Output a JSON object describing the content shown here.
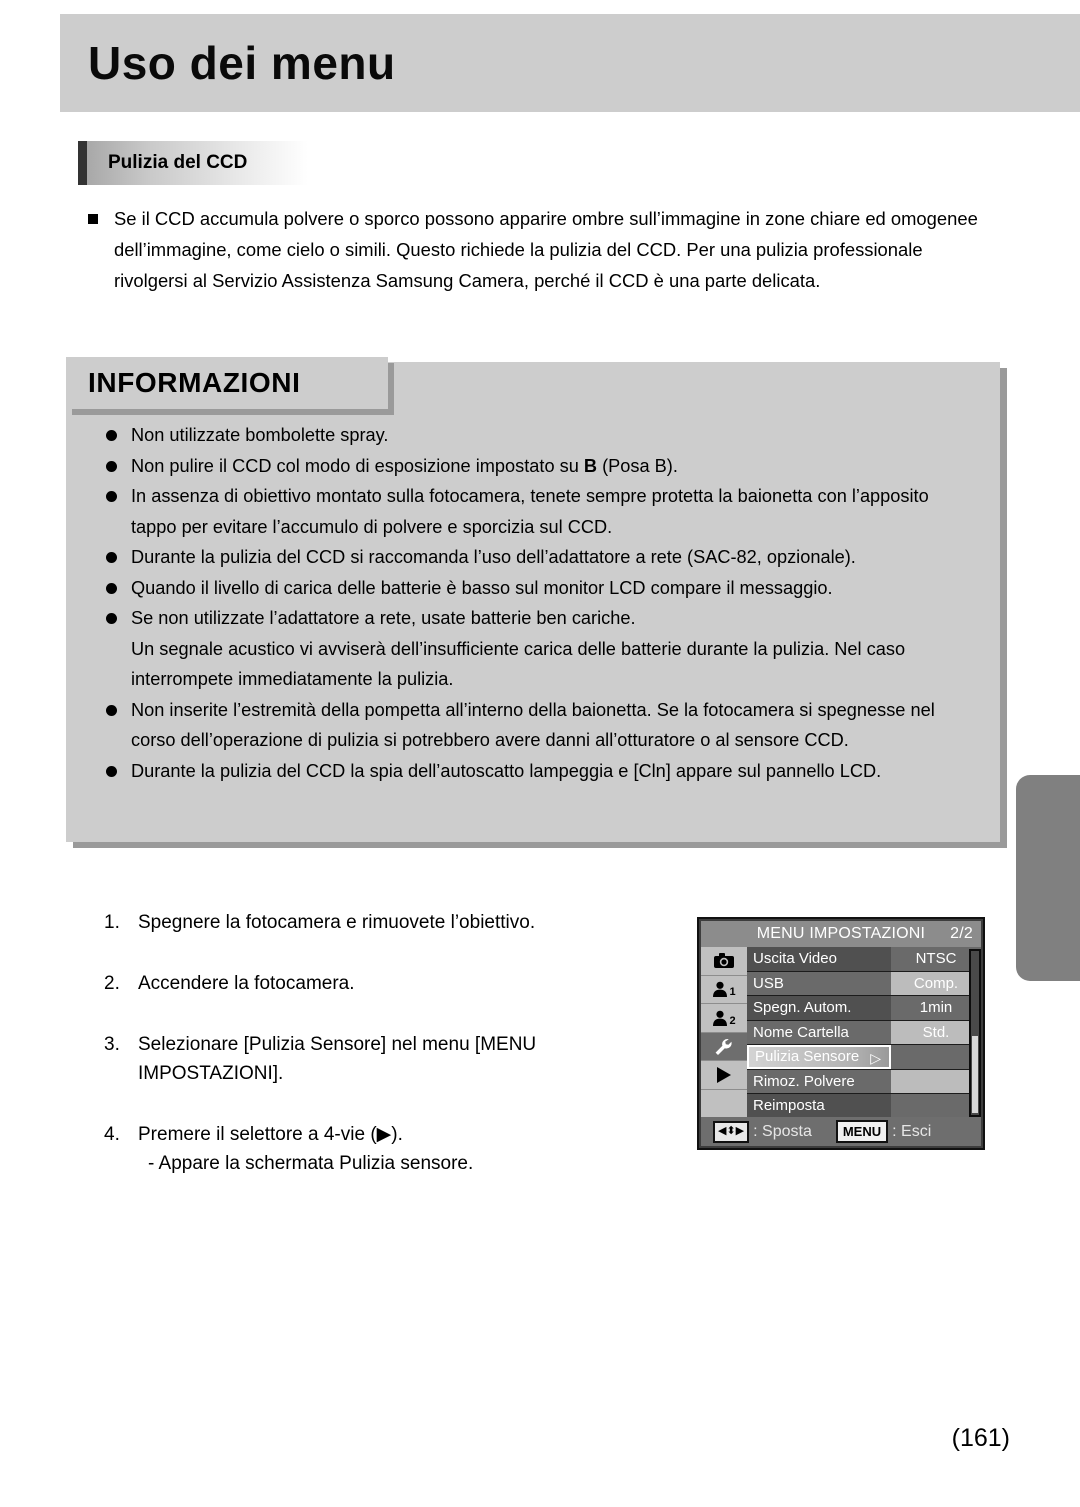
{
  "header": {
    "title": "Uso dei menu"
  },
  "section": {
    "subtitle": "Pulizia del CCD"
  },
  "intro": {
    "bullet_icon": "square-bullet-icon",
    "text": "Se il CCD accumula polvere o sporco possono apparire ombre sull’immagine in zone chiare ed omogenee dell’immagine, come cielo o simili. Questo richiede la pulizia del CCD. Per una pulizia professionale rivolgersi al Servizio Assistenza Samsung Camera, perché il CCD è una parte delicata."
  },
  "info": {
    "tag": "INFORMAZIONI",
    "items": [
      {
        "text": "Non utilizzate bombolette spray."
      },
      {
        "pre": "Non pulire il CCD col modo di esposizione impostato su ",
        "bold": "B",
        "post": " (Posa B)."
      },
      {
        "text": "In assenza di obiettivo montato sulla fotocamera, tenete sempre protetta la baionetta con l’apposito tappo per evitare l’accumulo di polvere e sporcizia sul CCD."
      },
      {
        "text": "Durante la pulizia del CCD si raccomanda l’uso dell’adattatore a rete (SAC-82, opzionale)."
      },
      {
        "text": "Quando il livello di carica delle batterie è basso sul monitor LCD compare il messaggio."
      },
      {
        "text": "Se non utilizzate l’adattatore a rete, usate batterie ben cariche.",
        "cont": "Un segnale acustico vi avviserà dell’insufficiente carica delle batterie durante la pulizia. Nel caso interrompete immediatamente la pulizia."
      },
      {
        "text": "Non inserite l’estremità della pompetta all’interno della baionetta. Se la fotocamera si spegnesse nel corso dell’operazione di pulizia si potrebbero avere danni all’otturatore o al sensore CCD."
      },
      {
        "text": "Durante la pulizia del CCD la spia dell’autoscatto lampeggia e [Cln] appare sul pannello LCD."
      }
    ]
  },
  "steps": [
    {
      "num": "1.",
      "text": "Spegnere la fotocamera e rimuovete l’obiettivo."
    },
    {
      "num": "2.",
      "text": "Accendere la fotocamera."
    },
    {
      "num": "3.",
      "text": "Selezionare [Pulizia Sensore] nel menu [MENU",
      "line2": "IMPOSTAZIONI]."
    },
    {
      "num": "4.",
      "text": "Premere il selettore a 4-vie (▶).",
      "sub": "- Appare la schermata Pulizia sensore."
    }
  ],
  "lcd": {
    "title": "MENU IMPOSTAZIONI",
    "page": "2/2",
    "icons": [
      {
        "name": "camera-icon",
        "sub": "",
        "selected": false
      },
      {
        "name": "user1-icon",
        "sub": "1",
        "selected": false
      },
      {
        "name": "user2-icon",
        "sub": "2",
        "selected": false
      },
      {
        "name": "wrench-icon",
        "sub": "",
        "selected": true
      },
      {
        "name": "play-icon",
        "sub": "",
        "selected": false
      }
    ],
    "rows": [
      {
        "label": "Uscita Video",
        "value": "NTSC",
        "label_tone": "tone-dark",
        "value_tone": "tone-mid",
        "selected": false,
        "corner": false
      },
      {
        "label": "USB",
        "value": "Comp.",
        "label_tone": "tone-mid",
        "value_tone": "tone-light",
        "selected": false,
        "corner": false
      },
      {
        "label": "Spegn. Autom.",
        "value": "1min",
        "label_tone": "tone-dark",
        "value_tone": "tone-mid",
        "selected": false,
        "corner": false
      },
      {
        "label": "Nome Cartella",
        "value": "Std.",
        "label_tone": "tone-mid",
        "value_tone": "tone-light",
        "selected": false,
        "corner": false
      },
      {
        "label": "Pulizia Sensore",
        "value": "",
        "label_tone": "tone-light",
        "value_tone": "tone-mid",
        "selected": true,
        "corner": true
      },
      {
        "label": "Rimoz. Polvere",
        "value": "",
        "label_tone": "tone-mid",
        "value_tone": "tone-light",
        "selected": false,
        "corner": true
      },
      {
        "label": "Reimposta",
        "value": "",
        "label_tone": "tone-dark",
        "value_tone": "tone-mid",
        "selected": false,
        "corner": true
      }
    ],
    "footer": {
      "key_4way": "◀⬍▶",
      "move_label": ": Sposta",
      "key_menu": "MENU",
      "exit_label": ": Esci"
    }
  },
  "page_number": "(161)"
}
